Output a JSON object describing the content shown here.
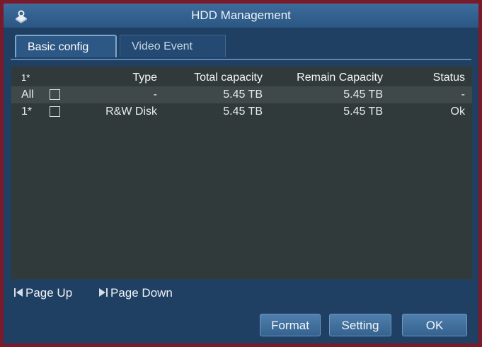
{
  "window": {
    "title": "HDD Management",
    "icon": "hdd-settings-icon"
  },
  "tabs": [
    {
      "label": "Basic config",
      "active": true
    },
    {
      "label": "Video Event",
      "active": false
    }
  ],
  "table": {
    "headers": {
      "id": "1*",
      "type": "Type",
      "total": "Total capacity",
      "remain": "Remain Capacity",
      "status": "Status"
    },
    "rows": [
      {
        "id": "All",
        "checked": false,
        "type": "-",
        "total": "5.45 TB",
        "remain": "5.45 TB",
        "status": "-"
      },
      {
        "id": "1*",
        "checked": false,
        "type": "R&W Disk",
        "total": "5.45 TB",
        "remain": "5.45 TB",
        "status": "Ok"
      }
    ]
  },
  "pager": {
    "page_up": "Page Up",
    "page_down": "Page Down"
  },
  "buttons": {
    "format": "Format",
    "setting": "Setting",
    "ok": "OK"
  },
  "colors": {
    "window_bg": "#1f3f63",
    "titlebar": "#2b5683",
    "table_bg": "#313a3a",
    "outer_frame": "#7a1a2a"
  }
}
